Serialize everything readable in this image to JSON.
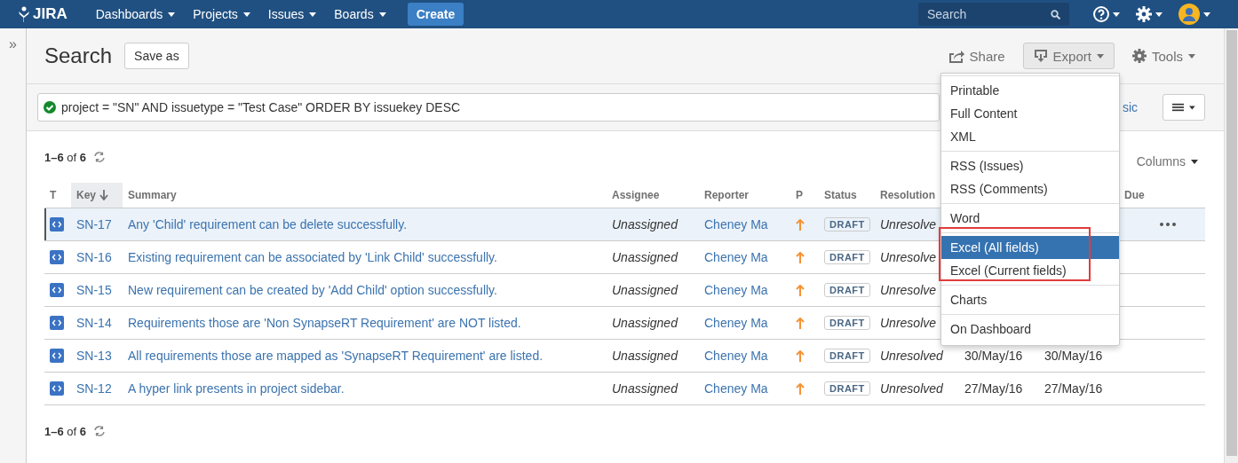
{
  "nav": {
    "logo": "JIRA",
    "menus": [
      {
        "label": "Dashboards"
      },
      {
        "label": "Projects"
      },
      {
        "label": "Issues"
      },
      {
        "label": "Boards"
      }
    ],
    "create": "Create",
    "search": {
      "placeholder": "Search"
    }
  },
  "sidebar": {
    "toggle": "»"
  },
  "header": {
    "title": "Search",
    "save_as": "Save as",
    "actions": [
      {
        "label": "Share",
        "kind": "share",
        "selected": false
      },
      {
        "label": "Export",
        "kind": "export",
        "selected": true
      },
      {
        "label": "Tools",
        "kind": "tools",
        "selected": false
      }
    ]
  },
  "query": {
    "value": "project = \"SN\" AND issuetype = \"Test Case\" ORDER BY issuekey DESC",
    "valid": true,
    "mode_link": "sic"
  },
  "results": {
    "count_top": "**1–6** of **6**",
    "columns_button": "Columns",
    "count_bottom": "**1–6** of **6**"
  },
  "table": {
    "columns": [
      {
        "kind": "type",
        "label": "T",
        "sorted": false
      },
      {
        "kind": "key",
        "label": "Key",
        "sorted": true
      },
      {
        "kind": "summary",
        "label": "Summary",
        "sorted": false
      },
      {
        "kind": "assignee",
        "label": "Assignee",
        "sorted": false
      },
      {
        "kind": "reporter",
        "label": "Reporter",
        "sorted": false
      },
      {
        "kind": "priority",
        "label": "P",
        "sorted": false
      },
      {
        "kind": "status",
        "label": "Status",
        "sorted": false
      },
      {
        "kind": "resolution",
        "label": "Resolution",
        "sorted": false
      },
      {
        "kind": "due",
        "label": "Due",
        "sorted": false
      }
    ],
    "rows": [
      {
        "key": "SN-17",
        "summary": "Any 'Child' requirement can be delete successfully.",
        "assignee": "Unassigned",
        "reporter": "Cheney Ma",
        "status": "DRAFT",
        "resolution": "Unresolve",
        "selected": true
      },
      {
        "key": "SN-16",
        "summary": "Existing requirement can be associated by 'Link Child' successfully.",
        "assignee": "Unassigned",
        "reporter": "Cheney Ma",
        "status": "DRAFT",
        "resolution": "Unresolve",
        "selected": false
      },
      {
        "key": "SN-15",
        "summary": "New requirement can be created by 'Add Child' option successfully.",
        "assignee": "Unassigned",
        "reporter": "Cheney Ma",
        "status": "DRAFT",
        "resolution": "Unresolve",
        "selected": false
      },
      {
        "key": "SN-14",
        "summary": "Requirements those are 'Non SynapseRT Requirement' are NOT listed.",
        "assignee": "Unassigned",
        "reporter": "Cheney Ma",
        "status": "DRAFT",
        "resolution": "Unresolve",
        "selected": false
      },
      {
        "key": "SN-13",
        "summary": "All requirements those are mapped as 'SynapseRT Requirement' are listed.",
        "assignee": "Unassigned",
        "reporter": "Cheney Ma",
        "status": "DRAFT",
        "resolution": "Unresolved",
        "created": "30/May/16",
        "updated": "30/May/16",
        "selected": false
      },
      {
        "key": "SN-12",
        "summary": "A hyper link presents in project sidebar.",
        "assignee": "Unassigned",
        "reporter": "Cheney Ma",
        "status": "DRAFT",
        "resolution": "Unresolved",
        "created": "27/May/16",
        "updated": "27/May/16",
        "selected": false
      }
    ]
  },
  "export_menu": {
    "groups": [
      {
        "highlighted": false,
        "items": [
          {
            "label": "Printable",
            "selected": false
          },
          {
            "label": "Full Content",
            "selected": false
          },
          {
            "label": "XML",
            "selected": false
          }
        ]
      },
      {
        "highlighted": false,
        "items": [
          {
            "label": "RSS (Issues)",
            "selected": false
          },
          {
            "label": "RSS (Comments)",
            "selected": false
          }
        ]
      },
      {
        "highlighted": false,
        "items": [
          {
            "label": "Word",
            "selected": false
          }
        ]
      },
      {
        "highlighted": true,
        "items": [
          {
            "label": "Excel (All fields)",
            "selected": true
          },
          {
            "label": "Excel (Current fields)",
            "selected": false
          }
        ]
      },
      {
        "highlighted": false,
        "items": [
          {
            "label": "Charts",
            "selected": false
          }
        ]
      },
      {
        "highlighted": false,
        "items": [
          {
            "label": "On Dashboard",
            "selected": false
          }
        ]
      }
    ]
  }
}
